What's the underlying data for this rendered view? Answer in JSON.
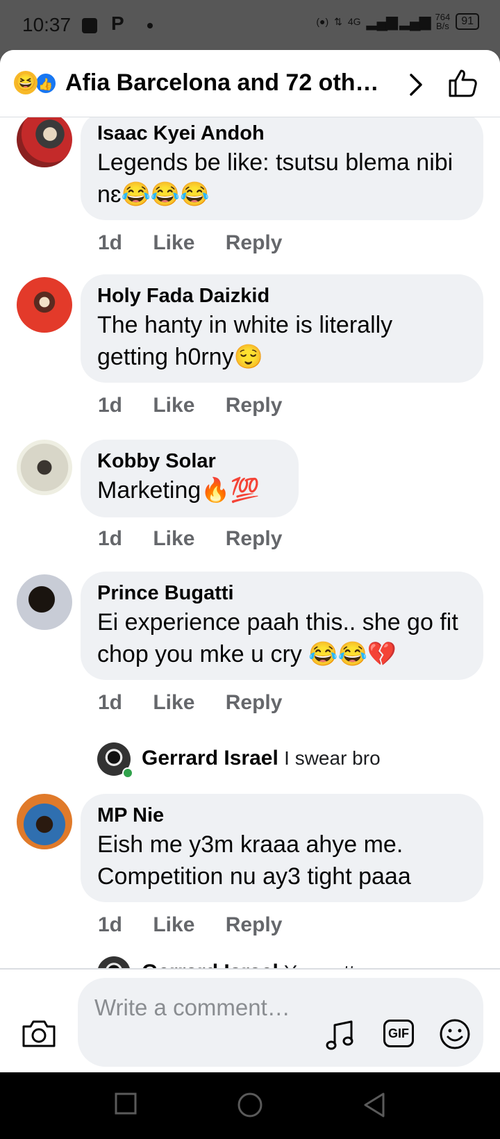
{
  "status_bar": {
    "time": "10:37",
    "notif_p": "P",
    "network": "4G",
    "speed": "764\nB/s",
    "battery": "91"
  },
  "header": {
    "title": "Afia Barcelona and 72 oth…"
  },
  "comments": [
    {
      "name": "Isaac Kyei Andoh",
      "text": "Legends be like: tsutsu blema nibi nɛ😂😂😂",
      "time": "1d",
      "like": "Like",
      "reply": "Reply"
    },
    {
      "name": "Holy Fada Daizkid",
      "text": "The hanty in white is literally getting h0rny😌",
      "time": "1d",
      "like": "Like",
      "reply": "Reply"
    },
    {
      "name": "Kobby Solar",
      "text": "Marketing🔥💯",
      "time": "1d",
      "like": "Like",
      "reply": "Reply"
    },
    {
      "name": "Prince Bugatti",
      "text": "Ei experience paah this.. she go fit chop you mke u cry 😂😂💔",
      "time": "1d",
      "like": "Like",
      "reply": "Reply"
    },
    {
      "name": "MP Nie",
      "text": "Eish me y3m kraaa ahye me. Competition nu ay3 tight paaa",
      "time": "1d",
      "like": "Like",
      "reply": "Reply"
    }
  ],
  "replies": [
    {
      "name": "Gerrard Israel",
      "text": "I swear bro"
    },
    {
      "name": "Gerrard Israel",
      "text": "You gotta"
    }
  ],
  "composer": {
    "placeholder": "Write a comment…",
    "gif": "GIF"
  }
}
